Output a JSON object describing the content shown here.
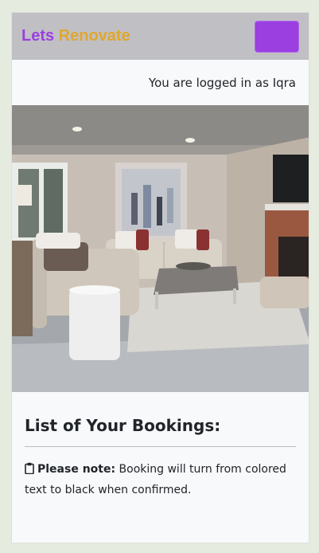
{
  "navbar": {
    "brand_word1": "Lets",
    "brand_word2": "Renovate",
    "toggler_icon": "menu-toggle",
    "brand_color1": "#9b3fe0",
    "brand_color2": "#e0a72c"
  },
  "session": {
    "login_text": "You are logged in as Iqra"
  },
  "hero": {
    "image_subject": "living room interior photo"
  },
  "bookings": {
    "heading": "List of Your Bookings:",
    "note_icon": "clipboard-icon",
    "note_label": "Please note:",
    "note_text": "Booking will turn from colored text to black when confirmed."
  }
}
